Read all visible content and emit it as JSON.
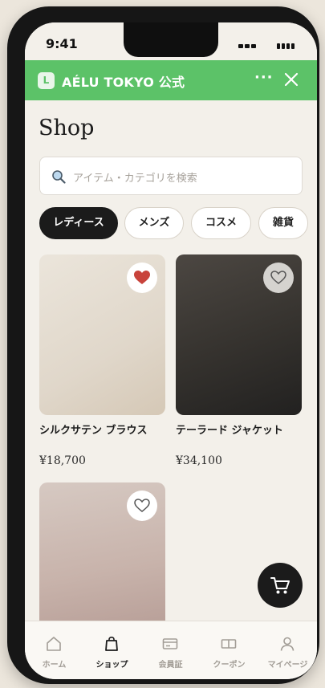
{
  "status_bar": {
    "time": "9:41"
  },
  "app_bar": {
    "logo_letter": "L",
    "title": "AÉLU TOKYO 公式",
    "more_label": "···",
    "accent": "#5cc268"
  },
  "page": {
    "heading": "Shop"
  },
  "search": {
    "placeholder": "アイテム・カテゴリを検索",
    "icon": "magnifier-icon"
  },
  "categories": [
    {
      "label": "レディース",
      "selected": true
    },
    {
      "label": "メンズ",
      "selected": false
    },
    {
      "label": "コスメ",
      "selected": false
    },
    {
      "label": "雑貨",
      "selected": false
    }
  ],
  "products": [
    {
      "name": "シルクサテン ブラウス",
      "price": "¥18,700",
      "favorited": true
    },
    {
      "name": "テーラード ジャケット",
      "price": "¥34,100",
      "favorited": false
    },
    {
      "name": "",
      "price": "",
      "favorited": false
    }
  ],
  "bottom_nav": [
    {
      "label": "ホーム",
      "icon": "home-icon",
      "active": false
    },
    {
      "label": "ショップ",
      "icon": "shopping-bag-icon",
      "active": true
    },
    {
      "label": "会員証",
      "icon": "member-card-icon",
      "active": false
    },
    {
      "label": "クーポン",
      "icon": "coupon-icon",
      "active": false
    },
    {
      "label": "マイページ",
      "icon": "user-icon",
      "active": false
    }
  ],
  "colors": {
    "heart_red": "#c8433b",
    "dark": "#1b1b1b",
    "background": "#f3f0ea"
  }
}
